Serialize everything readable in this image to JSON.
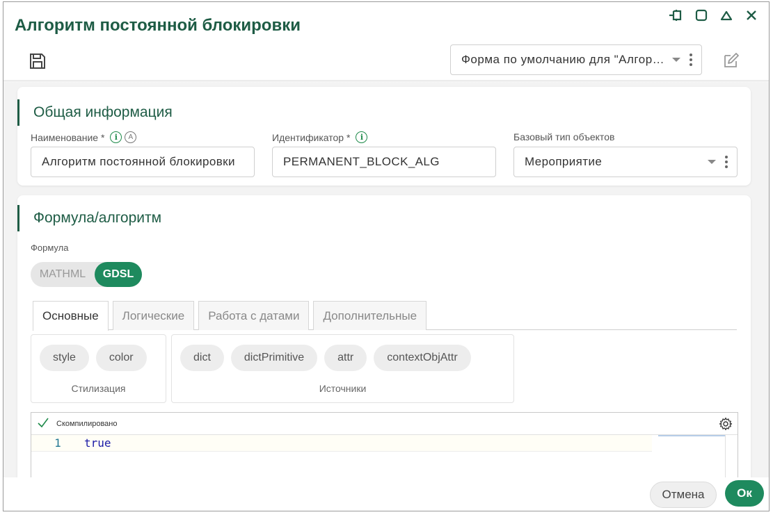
{
  "dialog": {
    "title": "Алгоритм постоянной блокировки",
    "form_select_value": "Форма по умолчанию для \"Алгоритм постоянной блокировки\""
  },
  "window_controls": [
    "pin-icon",
    "maximize-icon",
    "collapse-icon",
    "close-icon"
  ],
  "toolbar": {
    "save_icon": "floppy-disk-icon",
    "edit_icon": "edit-form-icon"
  },
  "general": {
    "title": "Общая информация",
    "name_label": "Наименование *",
    "name_value": "Алгоритм постоянной блокировки",
    "id_label": "Идентификатор *",
    "id_value": "PERMANENT_BLOCK_ALG",
    "base_type_label": "Базовый тип объектов",
    "base_type_value": "Мероприятие",
    "info_glyph": "i",
    "auto_glyph": "A"
  },
  "formula": {
    "title": "Формула/алгоритм",
    "label": "Формула",
    "mode_off": "MATHML",
    "mode_on": "GDSL",
    "tabs": [
      "Основные",
      "Логические",
      "Работа с датами",
      "Дополнительные"
    ],
    "active_tab": 0,
    "groups": [
      {
        "label": "Стилизация",
        "chips": [
          "style",
          "color"
        ]
      },
      {
        "label": "Источники",
        "chips": [
          "dict",
          "dictPrimitive",
          "attr",
          "contextObjAttr"
        ]
      }
    ],
    "editor": {
      "status": "Скомпилировано",
      "line_number": "1",
      "code": "true"
    }
  },
  "footer": {
    "cancel": "Отмена",
    "ok": "Ок"
  },
  "colors": {
    "brand": "#1e5c45",
    "accent": "#1e8a5e",
    "info": "#1e8a4a"
  }
}
